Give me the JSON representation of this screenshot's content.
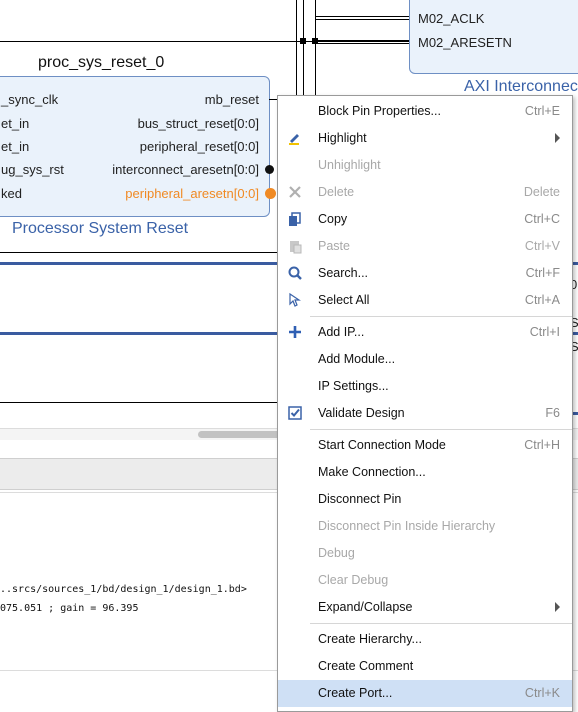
{
  "canvas": {
    "axi_block": {
      "pins": [
        "M02_ACLK",
        "M02_ARESETN"
      ],
      "type_label": "AXI Interconnect"
    },
    "right_partial_labels": [
      "0",
      "SU",
      "S"
    ],
    "reset_block": {
      "instance_name": "proc_sys_reset_0",
      "type_label": "Processor System Reset",
      "left_pins": [
        "_sync_clk",
        "et_in",
        "et_in",
        "ug_sys_rst",
        "ked"
      ],
      "right_pins": [
        "mb_reset",
        "bus_struct_reset[0:0]",
        "peripheral_reset[0:0]",
        "interconnect_aresetn[0:0]",
        "peripheral_aresetn[0:0]"
      ],
      "highlight_pin_color": "#f08a24"
    }
  },
  "log": {
    "lines": [
      "..srcs/sources_1/bd/design_1/design_1.bd>",
      "075.051 ; gain = 96.395"
    ]
  },
  "menu": {
    "items": [
      {
        "label": "Block Pin Properties...",
        "shortcut": "Ctrl+E"
      },
      {
        "label": "Highlight",
        "shortcut": ""
      },
      {
        "label": "Unhighlight",
        "shortcut": ""
      },
      {
        "label": "Delete",
        "shortcut": "Delete"
      },
      {
        "label": "Copy",
        "shortcut": "Ctrl+C"
      },
      {
        "label": "Paste",
        "shortcut": "Ctrl+V"
      },
      {
        "label": "Search...",
        "shortcut": "Ctrl+F"
      },
      {
        "label": "Select All",
        "shortcut": "Ctrl+A"
      },
      {
        "label": "Add IP...",
        "shortcut": "Ctrl+I"
      },
      {
        "label": "Add Module...",
        "shortcut": ""
      },
      {
        "label": "IP Settings...",
        "shortcut": ""
      },
      {
        "label": "Validate Design",
        "shortcut": "F6"
      },
      {
        "label": "Start Connection Mode",
        "shortcut": "Ctrl+H"
      },
      {
        "label": "Make Connection...",
        "shortcut": ""
      },
      {
        "label": "Disconnect Pin",
        "shortcut": ""
      },
      {
        "label": "Disconnect Pin Inside Hierarchy",
        "shortcut": ""
      },
      {
        "label": "Debug",
        "shortcut": ""
      },
      {
        "label": "Clear Debug",
        "shortcut": ""
      },
      {
        "label": "Expand/Collapse",
        "shortcut": ""
      },
      {
        "label": "Create Hierarchy...",
        "shortcut": ""
      },
      {
        "label": "Create Comment",
        "shortcut": ""
      },
      {
        "label": "Create Port...",
        "shortcut": "Ctrl+K"
      }
    ]
  },
  "colors": {
    "accent": "#3a62a8",
    "bus": "#3a5ba0",
    "selection": "#cfe0f5",
    "disabled_text": "#a8a8a8"
  },
  "icons": {
    "highlight": "pencil-highlight-icon",
    "delete": "delete-x-icon",
    "copy": "copy-icon",
    "paste": "paste-icon",
    "search": "search-icon",
    "select_all": "select-all-icon",
    "add_ip": "add-plus-icon",
    "validate": "validate-check-icon"
  }
}
